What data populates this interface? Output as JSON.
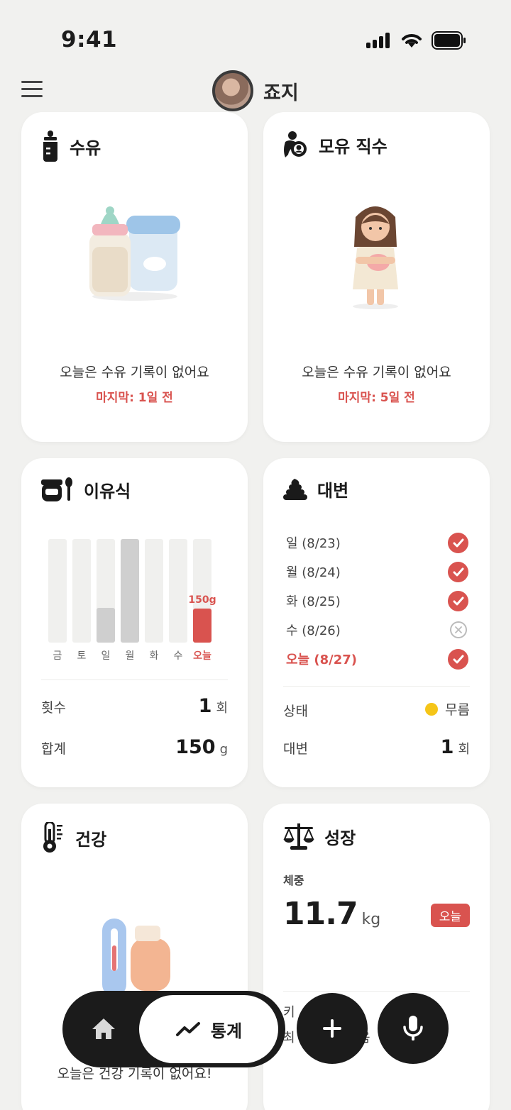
{
  "status": {
    "time": "9:41"
  },
  "header": {
    "profile_name": "죠지"
  },
  "cards": {
    "feeding": {
      "title": "수유",
      "empty_text": "오늘은 수유 기록이 없어요",
      "last_text": "마지막: 1일 전"
    },
    "breastfeeding": {
      "title": "모유 직수",
      "empty_text": "오늘은 수유 기록이 없어요",
      "last_text": "마지막: 5일 전"
    },
    "baby_food": {
      "title": "이유식",
      "chart_data": {
        "type": "bar",
        "categories": [
          "금",
          "토",
          "일",
          "월",
          "화",
          "수",
          "오늘"
        ],
        "values": [
          0,
          0,
          50,
          150,
          0,
          0,
          150
        ],
        "highlight_label": "150g",
        "ylim": [
          0,
          150
        ],
        "colors": {
          "default": "#cfcfcf",
          "today": "#d9534f",
          "track": "#f0f0ee"
        }
      },
      "count_label": "횟수",
      "count_value": "1",
      "count_unit": "회",
      "total_label": "합계",
      "total_value": "150",
      "total_unit": "g"
    },
    "stool": {
      "title": "대변",
      "days": [
        {
          "label": "일 (8/23)",
          "done": true
        },
        {
          "label": "월 (8/24)",
          "done": true
        },
        {
          "label": "화 (8/25)",
          "done": true
        },
        {
          "label": "수 (8/26)",
          "done": false
        },
        {
          "label": "오늘 (8/27)",
          "done": true
        }
      ],
      "status_label": "상태",
      "status_value": "무름",
      "status_color": "#f5c518",
      "count_label": "대변",
      "count_value": "1",
      "count_unit": "회"
    },
    "health": {
      "title": "건강",
      "empty_text": "오늘은 건강 기록이 없어요!"
    },
    "growth": {
      "title": "성장",
      "weight_label": "체중",
      "weight_value": "11.7",
      "weight_unit": "kg",
      "badge": "오늘",
      "height_label_partial": "키",
      "row2_partial": "최",
      "row2_tail": "음"
    }
  },
  "nav": {
    "stats_label": "통계"
  },
  "colors": {
    "accent": "#d9534f",
    "dark": "#1b1b1b",
    "background": "#f1f1ef"
  }
}
